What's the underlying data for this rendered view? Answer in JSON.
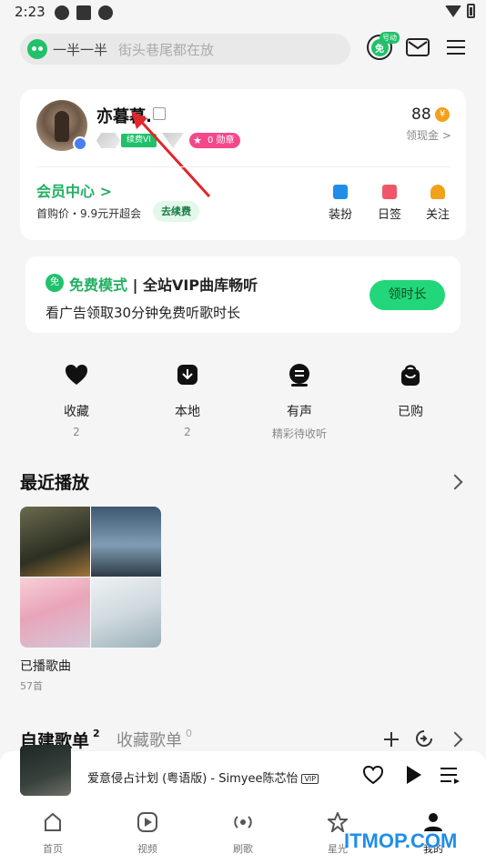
{
  "status_bar": {
    "time": "2:23"
  },
  "search": {
    "primary": "一半一半",
    "hint": "街头巷尾都在放"
  },
  "header": {
    "promo_tag": "号动",
    "free_icon_label": "免"
  },
  "profile": {
    "username": "亦暮暮.",
    "renew_badge": "续费VI",
    "medal_badge": "0 勋章",
    "coins": "88",
    "coin_symbol": "¥",
    "cash_link": "领现金 >",
    "member_center": "会员中心",
    "first_price": "首购价・9.9元开超会",
    "renew_button": "去续费",
    "shortcuts": [
      {
        "label": "装扮",
        "color": "#1f8ee8"
      },
      {
        "label": "日签",
        "color": "#f0566a"
      },
      {
        "label": "关注",
        "color": "#f2a11b"
      }
    ]
  },
  "free_mode": {
    "logo": "免",
    "title_green": "免费模式",
    "title_rest": "| 全站VIP曲库畅听",
    "desc": "看广告领取30分钟免费听歌时长",
    "button": "领时长"
  },
  "quick_access": [
    {
      "label": "收藏",
      "sub": "2",
      "icon": "heart-icon"
    },
    {
      "label": "本地",
      "sub": "2",
      "icon": "download-icon"
    },
    {
      "label": "有声",
      "sub": "精彩待收听",
      "icon": "audio-icon"
    },
    {
      "label": "已购",
      "sub": "",
      "icon": "bag-icon"
    }
  ],
  "recent": {
    "title": "最近播放",
    "playlist_name": "已播歌曲",
    "playlist_count": "57首"
  },
  "playlists_tabs": {
    "own_label": "自建歌单",
    "own_count": "2",
    "fav_label": "收藏歌单",
    "fav_count": "0"
  },
  "mini_player": {
    "title": "爱意侵占计划 (粤语版) - Simyee陈芯怡",
    "vip": "VIP"
  },
  "bottom_nav": [
    {
      "label": "首页",
      "icon": "home-icon"
    },
    {
      "label": "视频",
      "icon": "video-icon"
    },
    {
      "label": "刷歌",
      "icon": "radio-icon"
    },
    {
      "label": "星光",
      "icon": "star-icon"
    },
    {
      "label": "我的",
      "icon": "user-icon"
    }
  ],
  "watermark": "ITMOP.COM",
  "colors": {
    "brand_green": "#21c16b",
    "accent_blue": "#1f8ee8",
    "pink": "#f5488b"
  }
}
